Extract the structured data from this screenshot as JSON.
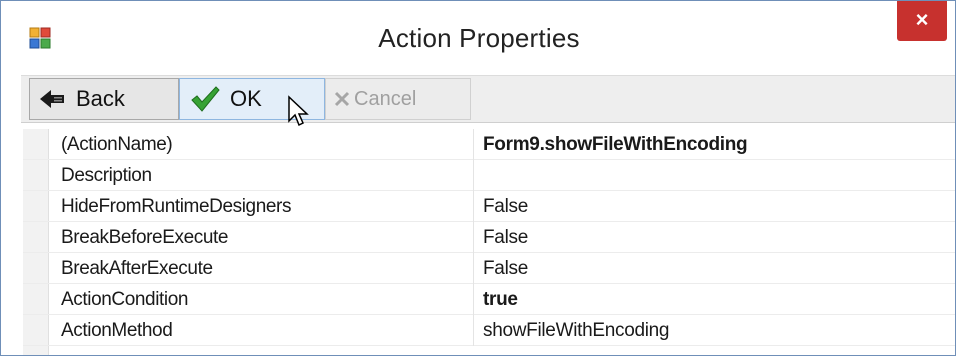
{
  "window": {
    "title": "Action Properties",
    "icon": "app-icon",
    "close_label": "×",
    "close_color": "#c7312e"
  },
  "toolbar": {
    "back_label": "Back",
    "back_icon": "back-arrow-icon",
    "ok_label": "OK",
    "ok_icon": "checkmark-icon",
    "cancel_label": "Cancel",
    "cancel_icon": "x-icon",
    "cancel_enabled": false
  },
  "properties": [
    {
      "name": "(ActionName)",
      "value": "Form9.showFileWithEncoding",
      "bold": true
    },
    {
      "name": "Description",
      "value": "",
      "bold": false
    },
    {
      "name": "HideFromRuntimeDesigners",
      "value": "False",
      "bold": false
    },
    {
      "name": "BreakBeforeExecute",
      "value": "False",
      "bold": false
    },
    {
      "name": "BreakAfterExecute",
      "value": "False",
      "bold": false
    },
    {
      "name": "ActionCondition",
      "value": "true",
      "bold": true
    },
    {
      "name": "ActionMethod",
      "value": "showFileWithEncoding",
      "bold": false
    }
  ]
}
